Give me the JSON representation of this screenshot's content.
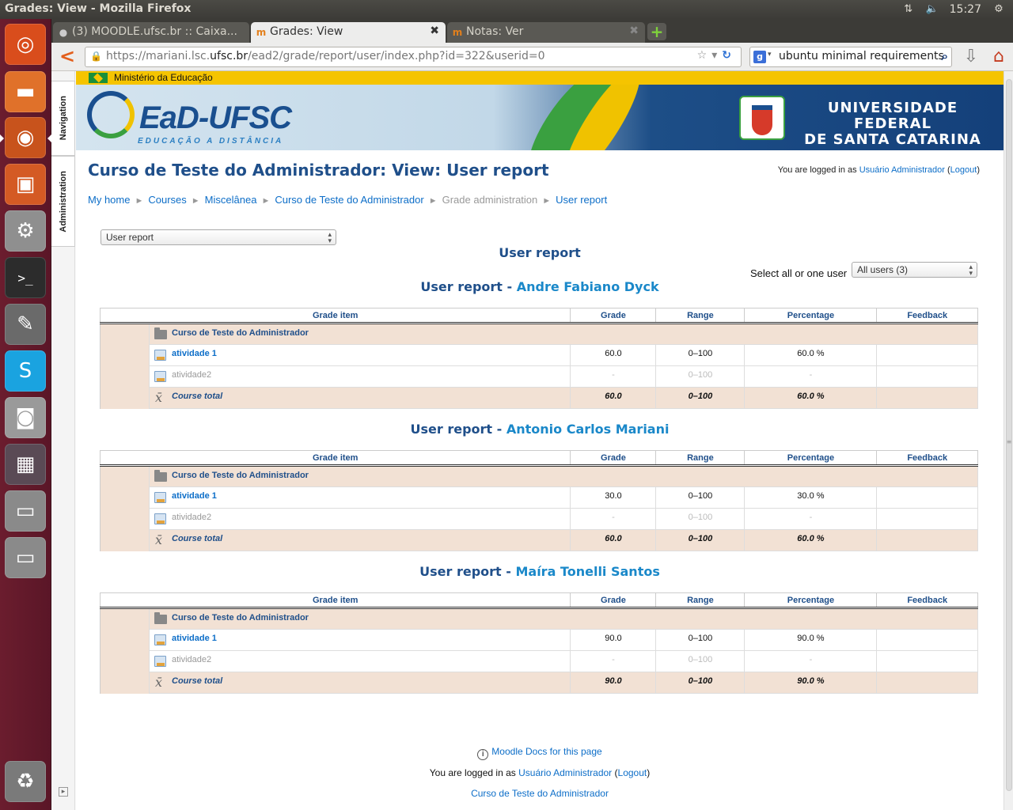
{
  "os": {
    "window_title": "Grades: View - Mozilla Firefox",
    "clock": "15:27"
  },
  "browser": {
    "tabs": [
      {
        "label": "(3) MOODLE.ufsc.br :: Caixa..."
      },
      {
        "label": "Grades: View"
      },
      {
        "label": "Notas: Ver"
      }
    ],
    "url_prefix": "https://mariani.lsc.",
    "url_domain": "ufsc.br",
    "url_suffix": "/ead2/grade/report/user/index.php?id=322&userid=0",
    "search_value": "ubuntu minimal requirements"
  },
  "sidebar": {
    "navigation": "Navigation",
    "administration": "Administration"
  },
  "header": {
    "ministerio": "Ministério da Educação",
    "logo": "EaD-UFSC",
    "logo_sub": "EDUCAÇÃO A DISTÂNCIA",
    "university_line1": "UNIVERSIDADE FEDERAL",
    "university_line2": "DE SANTA CATARINA"
  },
  "page": {
    "title": "Curso de Teste do Administrador: View: User report",
    "login_prefix": "You are logged in as",
    "login_user": "Usuário Administrador",
    "logout": "Logout",
    "breadcrumb": [
      "My home",
      "Courses",
      "Miscelânea",
      "Curso de Teste do Administrador",
      "Grade administration",
      "User report"
    ],
    "report_select": "User report",
    "report_title": "User report",
    "select_user_label": "Select all or one user",
    "select_user_value": "All users (3)"
  },
  "table_headers": [
    "Grade item",
    "Grade",
    "Range",
    "Percentage",
    "Feedback"
  ],
  "report_prefix": "User report - ",
  "reports": [
    {
      "student": "Andre Fabiano Dyck",
      "category": "Curso de Teste do Administrador",
      "rows": [
        {
          "item": "atividade 1",
          "grade": "60.0",
          "range": "0–100",
          "percentage": "60.0 %"
        },
        {
          "item": "atividade2",
          "grade": "-",
          "range": "0–100",
          "percentage": "-"
        }
      ],
      "total": {
        "item": "Course total",
        "grade": "60.0",
        "range": "0–100",
        "percentage": "60.0 %"
      }
    },
    {
      "student": "Antonio Carlos Mariani",
      "category": "Curso de Teste do Administrador",
      "rows": [
        {
          "item": "atividade 1",
          "grade": "30.0",
          "range": "0–100",
          "percentage": "30.0 %"
        },
        {
          "item": "atividade2",
          "grade": "-",
          "range": "0–100",
          "percentage": "-"
        }
      ],
      "total": {
        "item": "Course total",
        "grade": "60.0",
        "range": "0–100",
        "percentage": "60.0 %"
      }
    },
    {
      "student": "Maíra Tonelli Santos",
      "category": "Curso de Teste do Administrador",
      "rows": [
        {
          "item": "atividade 1",
          "grade": "90.0",
          "range": "0–100",
          "percentage": "90.0 %"
        },
        {
          "item": "atividade2",
          "grade": "-",
          "range": "0–100",
          "percentage": "-"
        }
      ],
      "total": {
        "item": "Course total",
        "grade": "90.0",
        "range": "0–100",
        "percentage": "90.0 %"
      }
    }
  ],
  "footer": {
    "docs_link": "Moodle Docs for this page",
    "login_prefix": "You are logged in as",
    "login_user": "Usuário Administrador",
    "logout": "Logout",
    "course_link": "Curso de Teste do Administrador"
  },
  "colors": {
    "launcher": "#5a1627",
    "moodle_blue": "#1f4f8a",
    "link": "#0d6ec8",
    "row_tint": "#f2e1d4",
    "banner_yellow": "#f5c400"
  }
}
